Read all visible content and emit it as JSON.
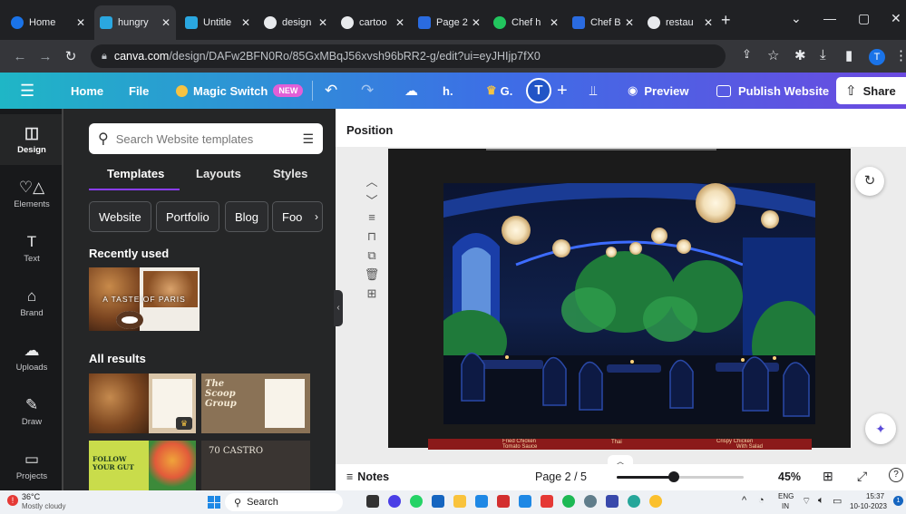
{
  "browser": {
    "tabs": [
      {
        "title": "Home",
        "color": "#1a73e8"
      },
      {
        "title": "hungry",
        "color": "#2aa7e0"
      },
      {
        "title": "Untitle",
        "color": "#2aa7e0"
      },
      {
        "title": "design",
        "color": "#e8eaed"
      },
      {
        "title": "cartoo",
        "color": "#e8eaed"
      },
      {
        "title": "Page 2",
        "color": "#2a6be0"
      },
      {
        "title": "Chef h",
        "color": "#22c55e"
      },
      {
        "title": "Chef B",
        "color": "#2a6be0"
      },
      {
        "title": "restau",
        "color": "#e8eaed"
      }
    ],
    "url_domain": "canva.com",
    "url_path": "/design/DAFw2BFN0Ro/85GxMBqJ56xvsh96bRR2-g/edit?ui=eyJHIjp7fX0",
    "profile_initial": "T"
  },
  "toolbar": {
    "home": "Home",
    "file": "File",
    "magic_switch": "Magic Switch",
    "new_badge": "NEW",
    "h_label": "h.",
    "g_label": "G.",
    "collaborator": "T",
    "preview": "Preview",
    "publish": "Publish Website",
    "share": "Share"
  },
  "rail": {
    "items": [
      {
        "label": "Design",
        "icon": "layout-icon"
      },
      {
        "label": "Elements",
        "icon": "shapes-icon"
      },
      {
        "label": "Text",
        "icon": "text-icon"
      },
      {
        "label": "Brand",
        "icon": "brand-icon"
      },
      {
        "label": "Uploads",
        "icon": "upload-icon"
      },
      {
        "label": "Draw",
        "icon": "draw-icon"
      },
      {
        "label": "Projects",
        "icon": "folder-icon"
      }
    ]
  },
  "panel": {
    "search_placeholder": "Search Website templates",
    "tabs": [
      "Templates",
      "Layouts",
      "Styles"
    ],
    "chips": [
      "Website",
      "Portfolio",
      "Blog",
      "Foo"
    ],
    "recently_used": "Recently used",
    "recent_template_text": "A TASTE OF PARIS",
    "all_results": "All results",
    "result_texts": [
      "The Scoop Group",
      "FOLLOW YOUR GUT",
      "70 CASTRO"
    ]
  },
  "canvas": {
    "position_label": "Position",
    "strip_labels": [
      "Fried Chicken",
      "Tomato Sauce",
      "Thai",
      "Crispy Chicken",
      "With Salad"
    ],
    "notes": "Notes",
    "page_indicator": "Page 2 / 5",
    "zoom": "45%",
    "zoom_level": 0.45
  },
  "taskbar": {
    "temperature": "36°C",
    "weather": "Mostly cloudy",
    "search": "Search",
    "lang_top": "ENG",
    "lang_bottom": "IN",
    "time": "15:37",
    "date": "10-10-2023"
  },
  "colors": {
    "accent_purple": "#8b3dff",
    "toolbar_start": "#1fb6c6",
    "toolbar_end": "#6b4ae0"
  }
}
